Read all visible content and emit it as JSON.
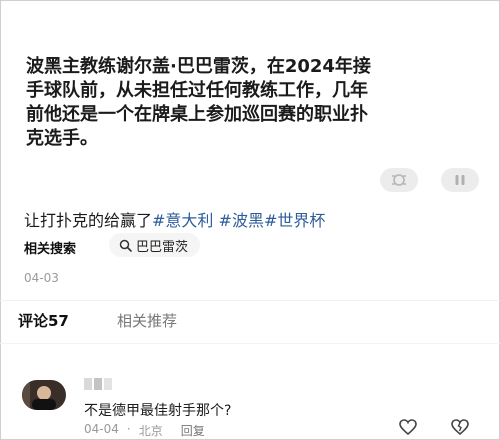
{
  "video_overlay": {
    "text": "波黑主教练谢尔盖·巴巴雷茨，在2024年接\n手球队前，从未担任过任何教练工作，几年\n前他还是一个在牌桌上参加巡回赛的职业扑\n克选手。"
  },
  "controls": {
    "left_icon": "screenshot-icon",
    "right_icon": "pause-icon"
  },
  "caption": {
    "text": "让打扑克的给赢了",
    "hashtags": [
      "#意大利",
      "#波黑",
      "#世界杯"
    ]
  },
  "related_search": {
    "label": "相关搜索",
    "chip": "巴巴雷茨"
  },
  "post_date": "04-03",
  "tabs": {
    "comments": "评论57",
    "recommended": "相关推荐"
  },
  "comment": {
    "text": "不是德甲最佳射手那个?",
    "date": "04-04",
    "location": "北京",
    "reply_label": "回复"
  }
}
